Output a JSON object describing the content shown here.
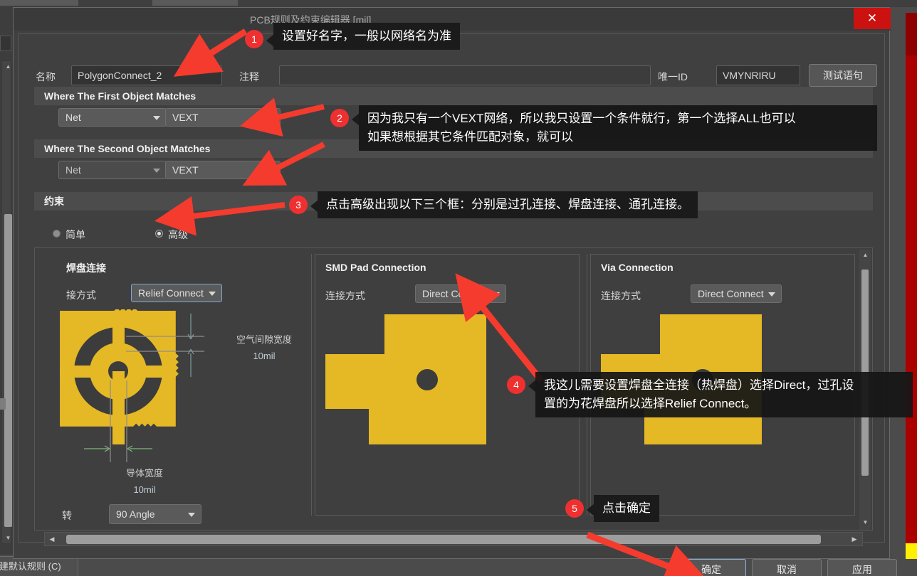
{
  "window": {
    "title": "PCB规则及约束编辑器 [mil]",
    "close_label": "✕"
  },
  "form": {
    "name_label": "名称",
    "name_value": "PolygonConnect_2",
    "comment_label": "注释",
    "comment_value": "",
    "uid_label": "唯一ID",
    "uid_value": "VMYNRIRU",
    "test_button": "测试语句"
  },
  "sections": {
    "first_match": "Where The First Object Matches",
    "second_match": "Where The Second Object Matches",
    "constraint": "约束"
  },
  "first_object": {
    "scope_type": "Net",
    "scope_value": "VEXT"
  },
  "second_object": {
    "scope_type": "Net",
    "scope_value": "VEXT"
  },
  "constraint_mode": {
    "simple_label": "简单",
    "advanced_label": "高级",
    "selected": "高级"
  },
  "pad_connection": {
    "title": "焊盘连接",
    "mode_label": "接方式",
    "mode_value": "Relief Connect",
    "air_gap_label": "空气间隙宽度",
    "air_gap_value": "10mil",
    "conductor_label": "导体宽度",
    "conductor_value": "10mil",
    "rotation_label": "转",
    "rotation_value": "90 Angle"
  },
  "smd_pad_connection": {
    "title": "SMD Pad Connection",
    "mode_label": "连接方式",
    "mode_value": "Direct Connect"
  },
  "via_connection": {
    "title": "Via Connection",
    "mode_label": "连接方式",
    "mode_value": "Direct Connect"
  },
  "dialog_buttons": {
    "ok": "确定",
    "cancel": "取消",
    "apply": "应用"
  },
  "background": {
    "default_rule_button": "建默认规则 (C)"
  },
  "annotations": [
    {
      "num": "1",
      "text": "设置好名字，一般以网络名为准"
    },
    {
      "num": "2",
      "text": "因为我只有一个VEXT网络，所以我只设置一个条件就行，第一个选择ALL也可以\n如果想根据其它条件匹配对象，就可以"
    },
    {
      "num": "3",
      "text": "点击高级出现以下三个框：分别是过孔连接、焊盘连接、通孔连接。"
    },
    {
      "num": "4",
      "text": "我这儿需要设置焊盘全连接（热焊盘）选择Direct，过孔设\n置的为花焊盘所以选择Relief Connect。"
    },
    {
      "num": "5",
      "text": "点击确定"
    }
  ],
  "colors": {
    "accent_red": "#ef3030",
    "copper": "#e5b825",
    "dialog_bg": "#404040",
    "close_red": "#cc1111"
  }
}
